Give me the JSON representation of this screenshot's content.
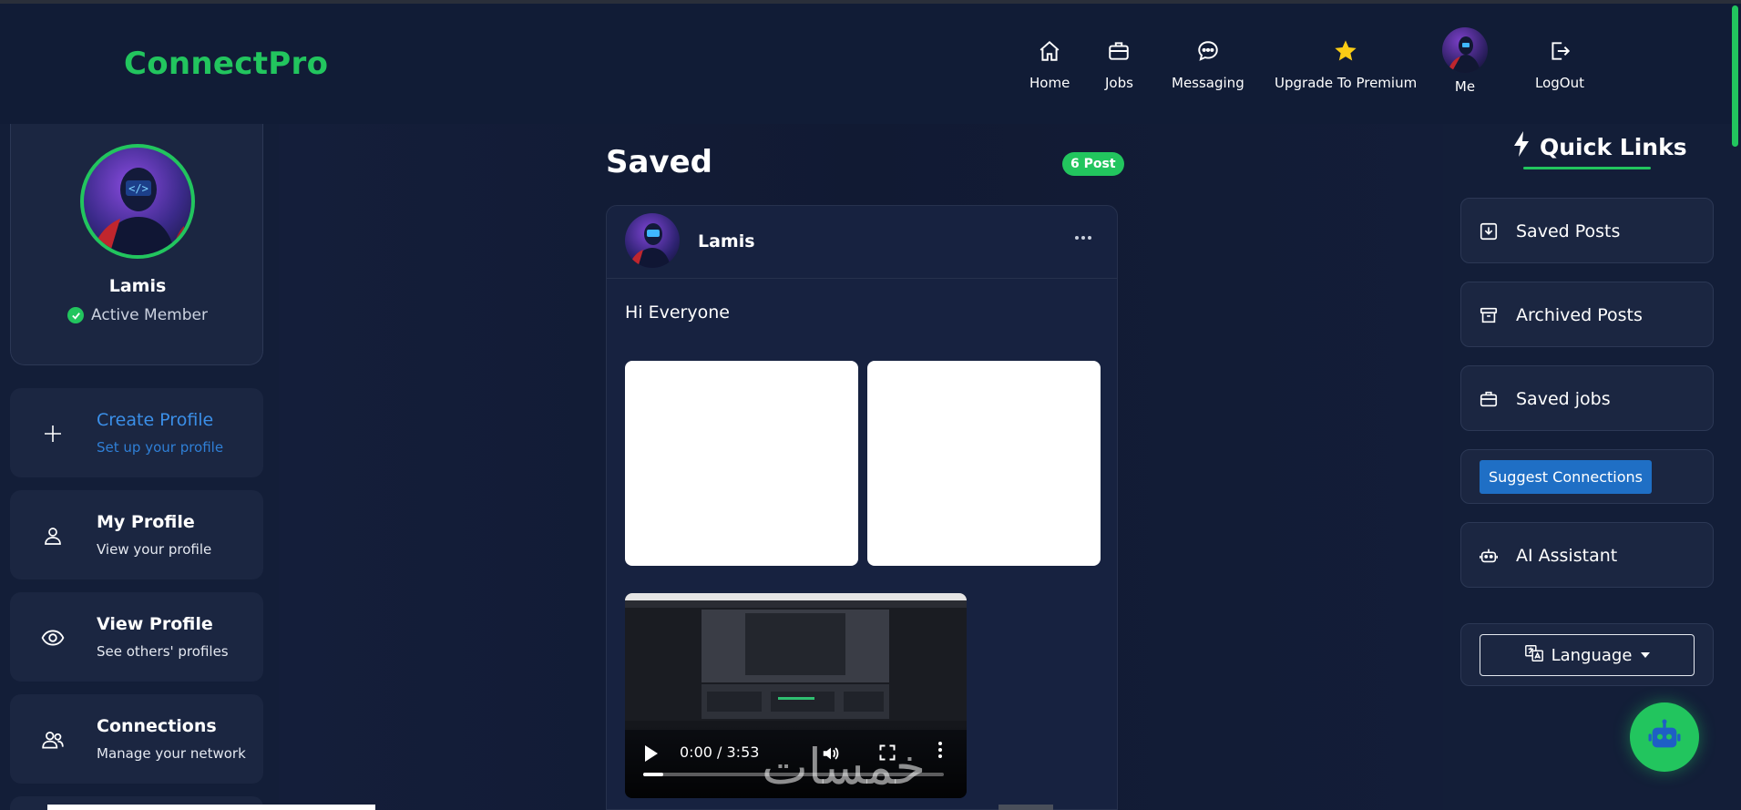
{
  "app": {
    "brand": "ConnectPro"
  },
  "nav": {
    "home": "Home",
    "jobs": "Jobs",
    "messaging": "Messaging",
    "premium": "Upgrade To Premium",
    "me": "Me",
    "logout": "LogOut"
  },
  "profile": {
    "name": "Lamis",
    "status": "Active Member"
  },
  "sidebar": {
    "items": [
      {
        "title": "Create Profile",
        "subtitle": "Set up your profile",
        "icon": "plus-icon"
      },
      {
        "title": "My Profile",
        "subtitle": "View your profile",
        "icon": "user-icon"
      },
      {
        "title": "View Profile",
        "subtitle": "See others' profiles",
        "icon": "eye-icon"
      },
      {
        "title": "Connections",
        "subtitle": "Manage your network",
        "icon": "people-icon"
      }
    ]
  },
  "main": {
    "title": "Saved",
    "badge": "6 Post",
    "post": {
      "author": "Lamis",
      "text": "Hi Everyone",
      "video_time": "0:00 / 3:53",
      "video_progress": 0.0
    },
    "watermark": "خمسات"
  },
  "quick_links": {
    "title": "Quick Links",
    "items": [
      {
        "label": "Saved Posts",
        "icon": "download-icon"
      },
      {
        "label": "Archived Posts",
        "icon": "archive-icon"
      },
      {
        "label": "Saved jobs",
        "icon": "briefcase-icon"
      },
      {
        "label": "Suggest Connections"
      },
      {
        "label": "AI Assistant",
        "icon": "robot-icon"
      }
    ],
    "language": "Language"
  },
  "colors": {
    "accent": "#22c55e",
    "link": "#3b8fe8",
    "bg": "#0f1a33",
    "card": "#1b2641"
  }
}
